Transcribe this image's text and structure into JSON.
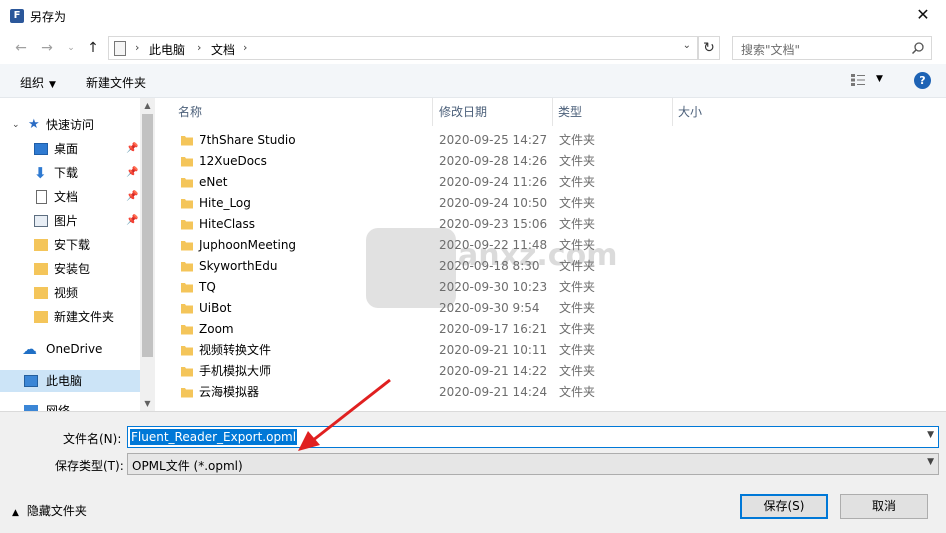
{
  "window": {
    "title": "另存为",
    "close_glyph": "✕",
    "app_icon_letter": "F"
  },
  "address": {
    "crumbs": [
      "此电脑",
      "文档"
    ],
    "separator": "›",
    "search_placeholder": "搜索\"文档\""
  },
  "toolbar": {
    "organize": "组织",
    "new_folder": "新建文件夹",
    "help": "?"
  },
  "nav": {
    "items": [
      {
        "label": "快速访问",
        "icon": "star-icon"
      },
      {
        "label": "桌面",
        "icon": "desktop-icon",
        "pinned": true
      },
      {
        "label": "下载",
        "icon": "download-icon",
        "pinned": true
      },
      {
        "label": "文档",
        "icon": "document-icon",
        "pinned": true
      },
      {
        "label": "图片",
        "icon": "picture-icon",
        "pinned": true
      },
      {
        "label": "安下载",
        "icon": "folder-icon"
      },
      {
        "label": "安装包",
        "icon": "folder-icon"
      },
      {
        "label": "视频",
        "icon": "folder-icon"
      },
      {
        "label": "新建文件夹",
        "icon": "folder-icon"
      },
      {
        "label": "OneDrive",
        "icon": "cloud-icon"
      },
      {
        "label": "此电脑",
        "icon": "computer-icon",
        "selected": true
      },
      {
        "label": "网络",
        "icon": "network-icon"
      }
    ]
  },
  "columns": {
    "name": "名称",
    "modified": "修改日期",
    "type": "类型",
    "size": "大小"
  },
  "files": [
    {
      "name": "7thShare Studio",
      "date": "2020-09-25 14:27",
      "type": "文件夹"
    },
    {
      "name": "12XueDocs",
      "date": "2020-09-28 14:26",
      "type": "文件夹"
    },
    {
      "name": "eNet",
      "date": "2020-09-24 11:26",
      "type": "文件夹"
    },
    {
      "name": "Hite_Log",
      "date": "2020-09-24 10:50",
      "type": "文件夹"
    },
    {
      "name": "HiteClass",
      "date": "2020-09-23 15:06",
      "type": "文件夹"
    },
    {
      "name": "JuphoonMeeting",
      "date": "2020-09-22 11:48",
      "type": "文件夹"
    },
    {
      "name": "SkyworthEdu",
      "date": "2020-09-18 8:30",
      "type": "文件夹"
    },
    {
      "name": "TQ",
      "date": "2020-09-30 10:23",
      "type": "文件夹"
    },
    {
      "name": "UiBot",
      "date": "2020-09-30 9:54",
      "type": "文件夹"
    },
    {
      "name": "Zoom",
      "date": "2020-09-17 16:21",
      "type": "文件夹"
    },
    {
      "name": "视频转换文件",
      "date": "2020-09-21 10:11",
      "type": "文件夹"
    },
    {
      "name": "手机模拟大师",
      "date": "2020-09-21 14:22",
      "type": "文件夹"
    },
    {
      "name": "云海模拟器",
      "date": "2020-09-21 14:24",
      "type": "文件夹"
    }
  ],
  "watermark": {
    "text": "anxz.com"
  },
  "bottom": {
    "filename_label": "文件名(N):",
    "filename_value": "Fluent_Reader_Export.opml",
    "filetype_label": "保存类型(T):",
    "filetype_value": "OPML文件 (*.opml)",
    "hide_folders": "隐藏文件夹",
    "save": "保存(S)",
    "cancel": "取消"
  },
  "colors": {
    "accent": "#0078d7",
    "folder": "#f4c55a",
    "annotation_arrow": "#e02020"
  }
}
